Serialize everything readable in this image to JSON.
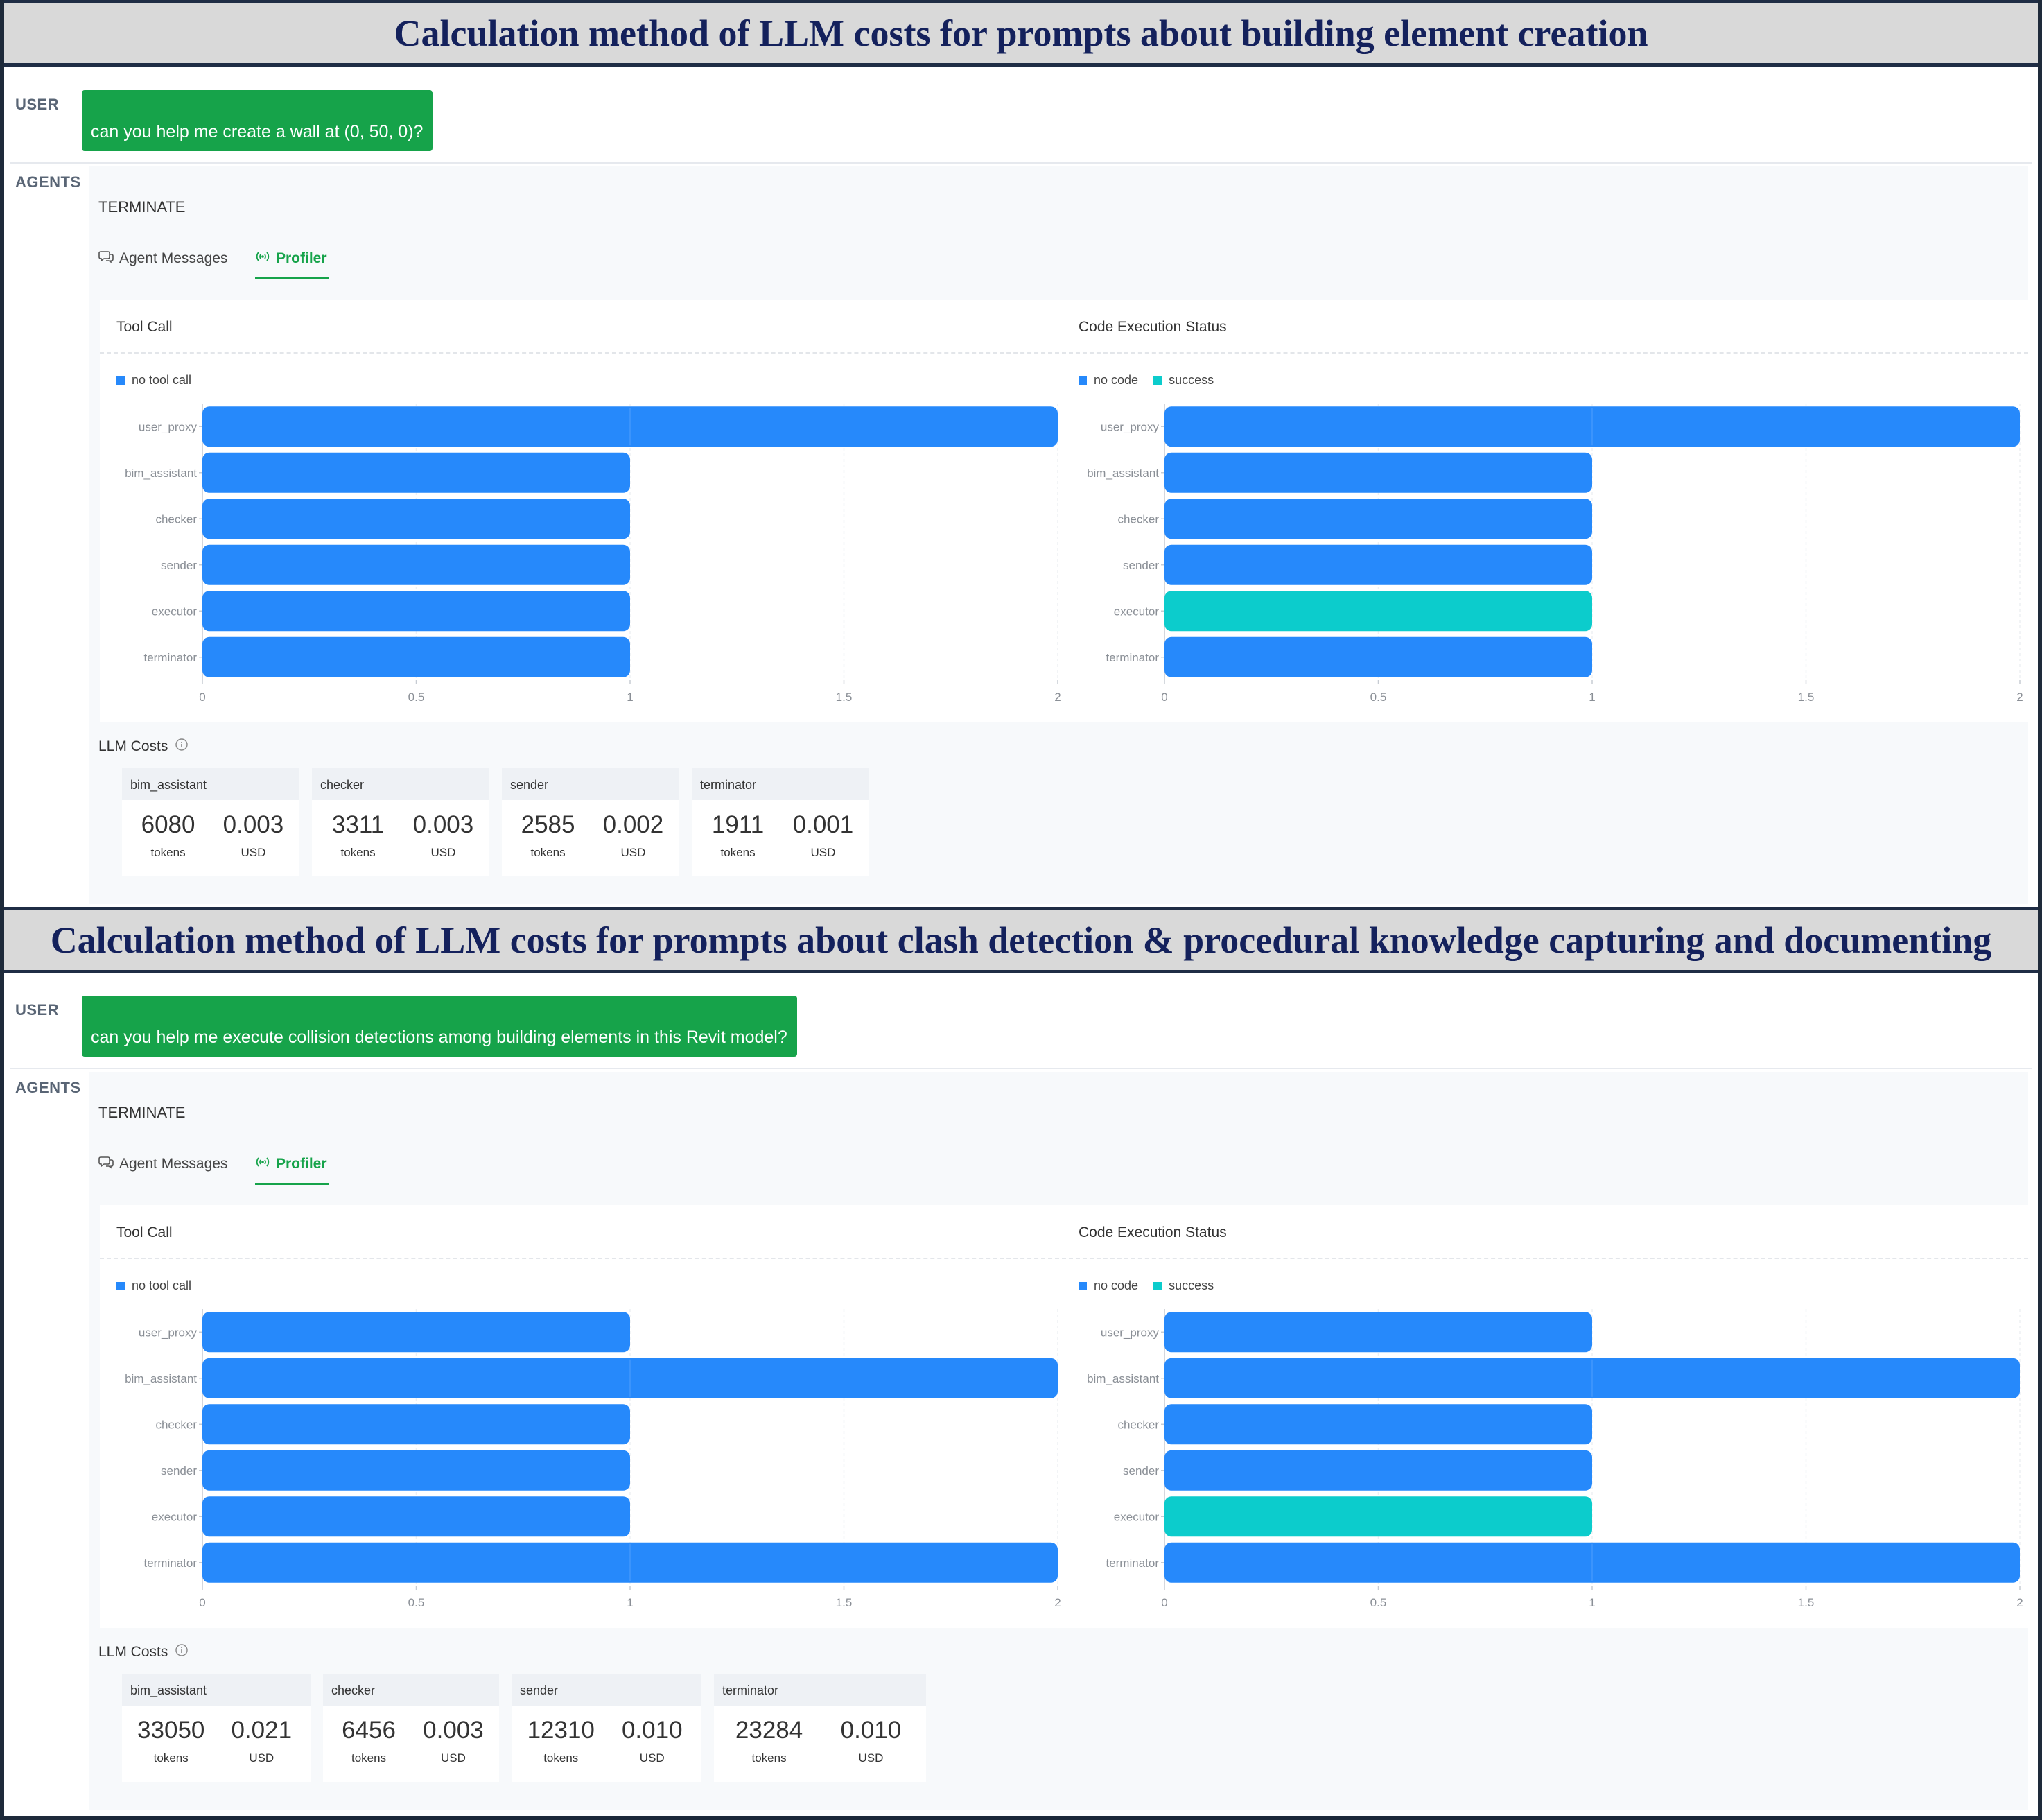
{
  "panels": [
    {
      "title": "Calculation method of LLM costs for prompts about building element creation",
      "user_label": "USER",
      "user_message": "can you help me create a wall at (0, 50, 0)?",
      "agents_label": "AGENTS",
      "status": "TERMINATE",
      "tabs": [
        {
          "label": "Agent Messages",
          "active": false
        },
        {
          "label": "Profiler",
          "active": true
        }
      ],
      "charts": [
        {
          "title": "Tool Call",
          "legend": [
            {
              "label": "no tool call",
              "color": "#2689fb"
            }
          ],
          "chart_data": {
            "type": "bar",
            "orientation": "horizontal",
            "stacked": true,
            "categories": [
              "user_proxy",
              "bim_assistant",
              "checker",
              "sender",
              "executor",
              "terminator"
            ],
            "series": [
              {
                "name": "no tool call",
                "color": "#2689fb",
                "values": [
                  2,
                  1,
                  1,
                  1,
                  1,
                  1
                ]
              }
            ],
            "xlim": [
              0,
              2
            ],
            "xticks": [
              "0",
              "0.5",
              "1",
              "1.5",
              "2"
            ]
          }
        },
        {
          "title": "Code Execution Status",
          "legend": [
            {
              "label": "no code",
              "color": "#2689fb"
            },
            {
              "label": "success",
              "color": "#0ccccc"
            }
          ],
          "chart_data": {
            "type": "bar",
            "orientation": "horizontal",
            "stacked": true,
            "categories": [
              "user_proxy",
              "bim_assistant",
              "checker",
              "sender",
              "executor",
              "terminator"
            ],
            "series": [
              {
                "name": "no code",
                "color": "#2689fb",
                "values": [
                  2,
                  1,
                  1,
                  1,
                  0,
                  1
                ]
              },
              {
                "name": "success",
                "color": "#0ccccc",
                "values": [
                  0,
                  0,
                  0,
                  0,
                  1,
                  0
                ]
              }
            ],
            "xlim": [
              0,
              2
            ],
            "xticks": [
              "0",
              "0.5",
              "1",
              "1.5",
              "2"
            ]
          }
        }
      ],
      "costs_label": "LLM Costs",
      "costs": [
        {
          "agent": "bim_assistant",
          "tokens": "6080",
          "usd": "0.003"
        },
        {
          "agent": "checker",
          "tokens": "3311",
          "usd": "0.003"
        },
        {
          "agent": "sender",
          "tokens": "2585",
          "usd": "0.002"
        },
        {
          "agent": "terminator",
          "tokens": "1911",
          "usd": "0.001"
        }
      ],
      "tokens_unit": "tokens",
      "usd_unit": "USD"
    },
    {
      "title": "Calculation method of LLM costs for prompts about clash detection & procedural knowledge capturing and documenting",
      "user_label": "USER",
      "user_message": "can you help me execute collision detections among building elements in this Revit model?",
      "agents_label": "AGENTS",
      "status": "TERMINATE",
      "tabs": [
        {
          "label": "Agent Messages",
          "active": false
        },
        {
          "label": "Profiler",
          "active": true
        }
      ],
      "charts": [
        {
          "title": "Tool Call",
          "legend": [
            {
              "label": "no tool call",
              "color": "#2689fb"
            }
          ],
          "chart_data": {
            "type": "bar",
            "orientation": "horizontal",
            "stacked": true,
            "categories": [
              "user_proxy",
              "bim_assistant",
              "checker",
              "sender",
              "executor",
              "terminator"
            ],
            "series": [
              {
                "name": "no tool call",
                "color": "#2689fb",
                "values": [
                  1,
                  2,
                  1,
                  1,
                  1,
                  2
                ]
              }
            ],
            "xlim": [
              0,
              2
            ],
            "xticks": [
              "0",
              "0.5",
              "1",
              "1.5",
              "2"
            ]
          }
        },
        {
          "title": "Code Execution Status",
          "legend": [
            {
              "label": "no code",
              "color": "#2689fb"
            },
            {
              "label": "success",
              "color": "#0ccccc"
            }
          ],
          "chart_data": {
            "type": "bar",
            "orientation": "horizontal",
            "stacked": true,
            "categories": [
              "user_proxy",
              "bim_assistant",
              "checker",
              "sender",
              "executor",
              "terminator"
            ],
            "series": [
              {
                "name": "no code",
                "color": "#2689fb",
                "values": [
                  1,
                  2,
                  1,
                  1,
                  0,
                  2
                ]
              },
              {
                "name": "success",
                "color": "#0ccccc",
                "values": [
                  0,
                  0,
                  0,
                  0,
                  1,
                  0
                ]
              }
            ],
            "xlim": [
              0,
              2
            ],
            "xticks": [
              "0",
              "0.5",
              "1",
              "1.5",
              "2"
            ]
          }
        }
      ],
      "costs_label": "LLM Costs",
      "costs": [
        {
          "agent": "bim_assistant",
          "tokens": "33050",
          "usd": "0.021"
        },
        {
          "agent": "checker",
          "tokens": "6456",
          "usd": "0.003"
        },
        {
          "agent": "sender",
          "tokens": "12310",
          "usd": "0.010"
        },
        {
          "agent": "terminator",
          "tokens": "23284",
          "usd": "0.010"
        }
      ],
      "tokens_unit": "tokens",
      "usd_unit": "USD"
    }
  ],
  "icons": {
    "messages": "chat-bubbles-icon",
    "profiler": "signal-icon",
    "info": "info-circle-icon"
  }
}
